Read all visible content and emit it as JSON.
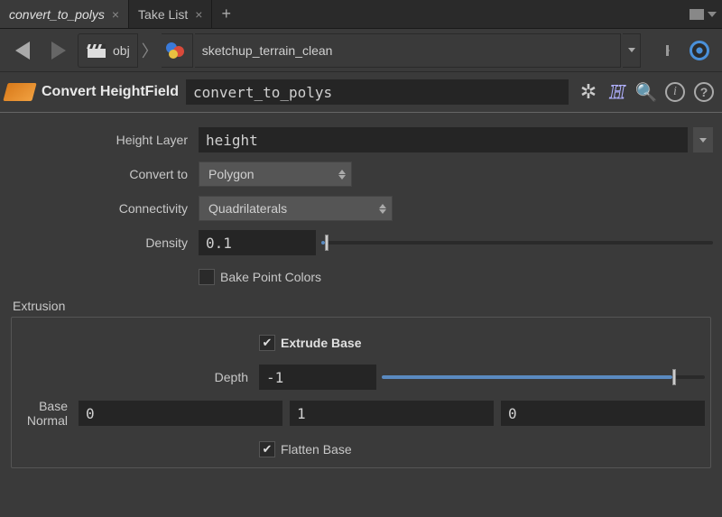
{
  "tabs": {
    "items": [
      {
        "label": "convert_to_polys",
        "active": true
      },
      {
        "label": "Take List",
        "active": false
      }
    ]
  },
  "nav": {
    "obj_label": "obj",
    "path_text": "sketchup_terrain_clean"
  },
  "op": {
    "type_label": "Convert HeightField",
    "name": "convert_to_polys"
  },
  "params": {
    "height_layer_label": "Height Layer",
    "height_layer_value": "height",
    "convert_to_label": "Convert to",
    "convert_to_value": "Polygon",
    "connectivity_label": "Connectivity",
    "connectivity_value": "Quadrilaterals",
    "density_label": "Density",
    "density_value": "0.1",
    "bake_label": "Bake Point Colors"
  },
  "extrusion": {
    "group_label": "Extrusion",
    "extrude_base_label": "Extrude Base",
    "extrude_base_checked": true,
    "depth_label": "Depth",
    "depth_value": "-1",
    "base_normal_label": "Base Normal",
    "base_normal": {
      "x": "0",
      "y": "1",
      "z": "0"
    },
    "flatten_base_label": "Flatten Base",
    "flatten_base_checked": true
  }
}
